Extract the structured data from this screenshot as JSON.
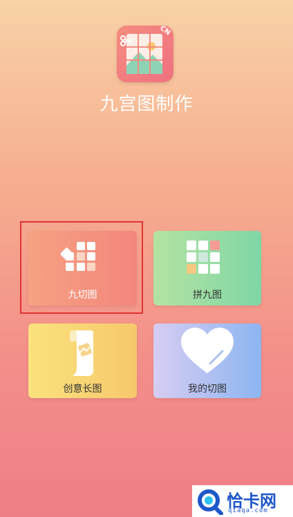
{
  "app": {
    "title": "九宫图制作",
    "icon_badge": "CN",
    "icon": "nine-grid-picture-icon"
  },
  "cards": [
    {
      "id": "nine-cut",
      "label": "九切图",
      "icon": "nine-grid-cut-icon",
      "colors": [
        "#f6a282",
        "#f3867c"
      ],
      "highlighted": true
    },
    {
      "id": "collage",
      "label": "拼九图",
      "icon": "nine-grid-collage-icon",
      "colors": [
        "#b4e3a2",
        "#7fd7a6"
      ]
    },
    {
      "id": "long-image",
      "label": "创意长图",
      "icon": "scroll-image-icon",
      "colors": [
        "#fbe27d",
        "#f6c86c"
      ]
    },
    {
      "id": "my-cuts",
      "label": "我的切图",
      "icon": "heart-icon",
      "colors": [
        "#d7cdf2",
        "#8cb5f1"
      ]
    }
  ],
  "highlight_color": "#e03333",
  "watermark": {
    "text": "恰卡网",
    "sub": "qiaqa.com",
    "color": "#1f57c9"
  }
}
